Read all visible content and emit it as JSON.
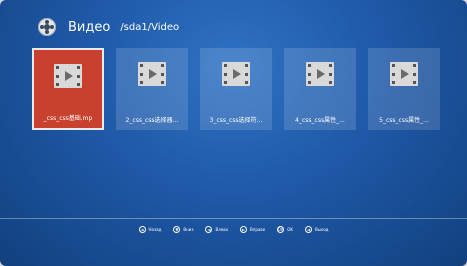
{
  "header": {
    "icon": "film-reel-icon",
    "title": "Видео",
    "path": "/sda1/Video"
  },
  "files": [
    {
      "label": "_css_css基础.mp",
      "selected": true
    },
    {
      "label": "2_css_css选择器...",
      "selected": false
    },
    {
      "label": "3_css_css选择符...",
      "selected": false
    },
    {
      "label": "4_css_css属性_...",
      "selected": false
    },
    {
      "label": "5_css_css属性_...",
      "selected": false
    }
  ],
  "footer": {
    "items": [
      {
        "key": "◄",
        "label": "Назад"
      },
      {
        "key": "▼",
        "label": "Вниз"
      },
      {
        "key": "◄",
        "label": "Влево"
      },
      {
        "key": "►",
        "label": "Вправо"
      },
      {
        "key": "OK",
        "label": "OK"
      },
      {
        "key": "◄",
        "label": "Выход"
      }
    ]
  },
  "colors": {
    "background": "#1f59a8",
    "selected_tile": "#c8412f"
  }
}
